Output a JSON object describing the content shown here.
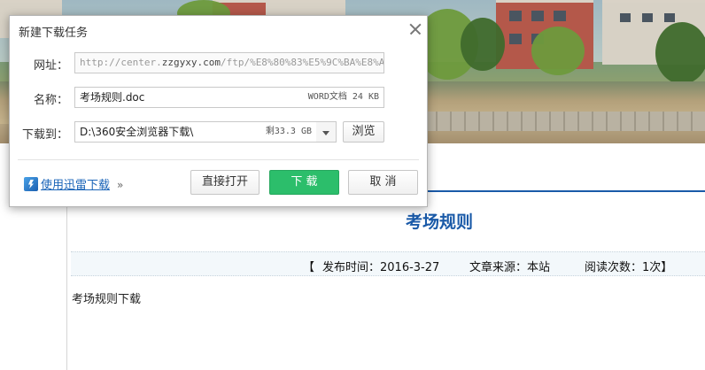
{
  "dialog": {
    "title": "新建下载任务",
    "url_label": "网址：",
    "url_prefix": "http://center.",
    "url_domain": "zzgyxy.com",
    "url_rest": "/ftp/%E8%80%83%E5%9C%BA%E8%A7%84%",
    "name_label": "名称：",
    "file_name": "考场规则.doc",
    "file_info": "WORD文档 24 KB",
    "save_label": "下载到：",
    "save_path": "D:\\360安全浏览器下载\\",
    "free_space": "剩33.3 GB",
    "browse_button": "浏览",
    "thunder_link": "使用迅雷下载",
    "thunder_chevron": "»",
    "open_button": "直接打开",
    "download_button": "下 载",
    "cancel_button": "取 消"
  },
  "page": {
    "article_title": "考场规则",
    "meta_open": "【",
    "publish_time": "发布时间：2016-3-27",
    "source": "文章来源：本站",
    "views": "阅读次数：1次】",
    "body_text": "考场规则下载"
  },
  "colors": {
    "primary_green": "#2cbe6b",
    "link_blue": "#1a64b8",
    "title_blue": "#1a5aa8"
  }
}
